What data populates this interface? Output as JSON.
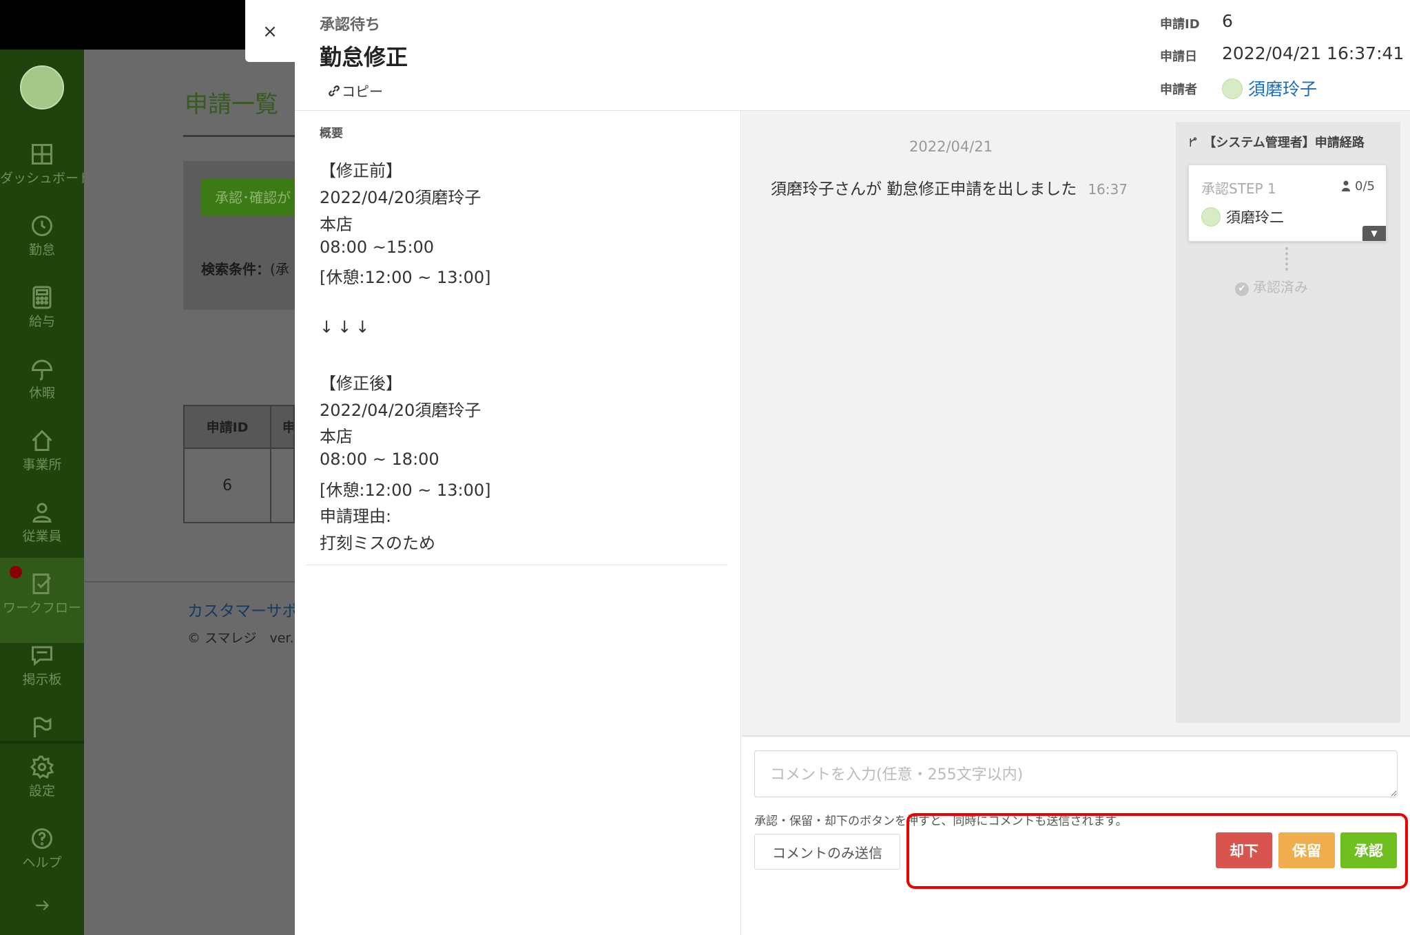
{
  "background": {
    "sidebar": {
      "items": [
        {
          "label": "ダッシュボード",
          "icon": "dashboard-icon"
        },
        {
          "label": "勤怠",
          "icon": "clock-icon"
        },
        {
          "label": "給与",
          "icon": "calculator-icon"
        },
        {
          "label": "休暇",
          "icon": "umbrella-icon"
        },
        {
          "label": "事業所",
          "icon": "home-icon"
        },
        {
          "label": "従業員",
          "icon": "person-icon"
        },
        {
          "label": "ワークフロー",
          "icon": "checklist-icon"
        },
        {
          "label": "掲示板",
          "icon": "message-icon"
        },
        {
          "label": "",
          "icon": "flag-icon"
        },
        {
          "label": "設定",
          "icon": "gear-icon"
        },
        {
          "label": "ヘルプ",
          "icon": "help-icon"
        }
      ],
      "expand_icon": "arrow-right-icon"
    },
    "page": {
      "title": "申請一覧",
      "bulk_button": "承認･確認が",
      "search_label": "検索条件：",
      "search_value": "(承",
      "table_headers": [
        "申請ID",
        "申"
      ],
      "table_rows": [
        [
          "6"
        ]
      ],
      "support_link": "カスタマーサポ",
      "copyright": "© スマレジ　ver."
    }
  },
  "modal": {
    "close_label": "×",
    "status": "承認待ち",
    "title": "勤怠修正",
    "copy_link": "コピー",
    "meta": {
      "id_label": "申請ID",
      "id_value": "6",
      "date_label": "申請日",
      "date_value": "2022/04/21 16:37:41",
      "applicant_label": "申請者",
      "applicant_value": "須磨玲子"
    },
    "overview": {
      "label": "概要",
      "lines": [
        "【修正前】",
        "2022/04/20須磨玲子",
        "本店",
        "08:00 ~15:00",
        "[休憩:12:00 ~ 13:00]",
        "",
        "↓↓↓",
        "",
        "【修正後】",
        "2022/04/20須磨玲子",
        "本店",
        "08:00 ~ 18:00",
        "[休憩:12:00 ~ 13:00]",
        "申請理由:",
        "打刻ミスのため"
      ]
    },
    "timeline": {
      "date": "2022/04/21",
      "message": "須磨玲子さんが 勤怠修正申請を出しました",
      "time": "16:37"
    },
    "route": {
      "title": "【システム管理者】申請経路",
      "step_title": "承認STEP 1",
      "step_count": "0/5",
      "approver": "須磨玲二",
      "done_label": "承認済み"
    },
    "comment": {
      "placeholder": "コメントを入力(任意・255文字以内)",
      "note": "承認・保留・却下のボタンを押すと、同時にコメントも送信されます。",
      "send_only": "コメントのみ送信"
    },
    "actions": {
      "reject": "却下",
      "hold": "保留",
      "approve": "承認"
    }
  },
  "colors": {
    "sidebar_bg": "#1f430c",
    "reject": "#d9534f",
    "hold": "#f0ad4e",
    "approve": "#6fbf1f",
    "link": "#1a6ec0",
    "highlight": "#e00000"
  }
}
